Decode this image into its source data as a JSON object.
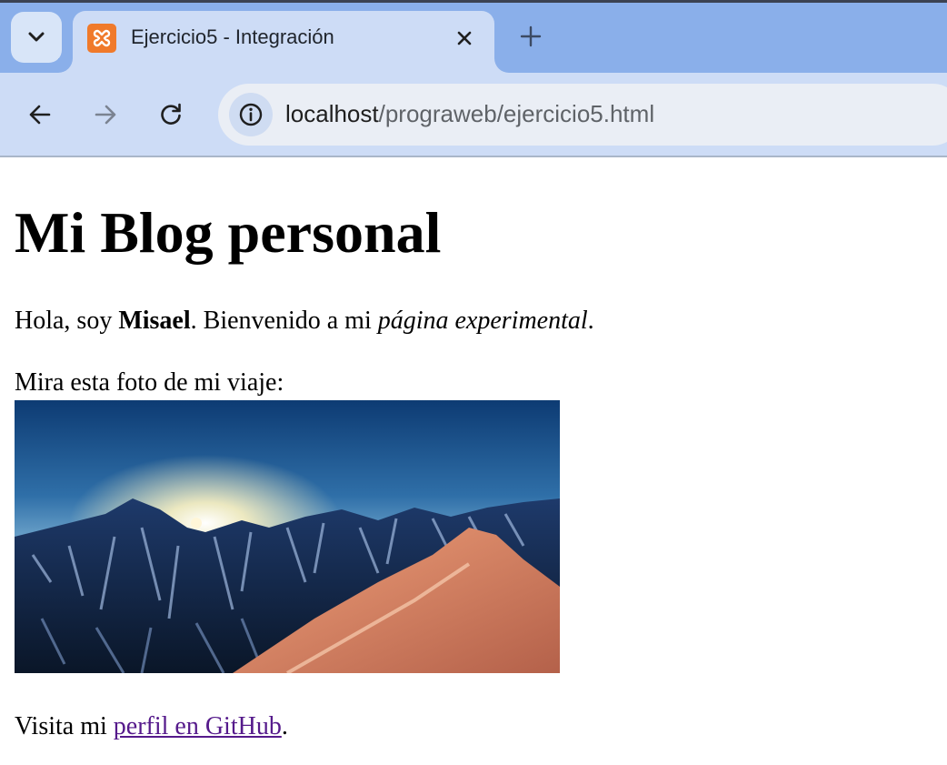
{
  "browser": {
    "tab": {
      "title": "Ejercicio5 - Integración",
      "favicon_icon": "xampp-icon",
      "favicon_color": "#f07a2b"
    },
    "tab_search_icon": "chevron-down-icon",
    "close_icon": "close-icon",
    "new_tab_icon": "plus-icon",
    "toolbar": {
      "back_icon": "arrow-left-icon",
      "forward_icon": "arrow-right-icon",
      "reload_icon": "reload-icon"
    },
    "address": {
      "host": "localhost",
      "path": "/prograweb/ejercicio5.html",
      "site_info_icon": "info-icon"
    },
    "colors": {
      "tabstrip": "#8aafea",
      "active_tab": "#cddcf6",
      "omnibox": "#eaeef5"
    }
  },
  "page": {
    "heading": "Mi Blog personal",
    "intro": {
      "prefix": "Hola, soy ",
      "name": "Misael",
      "middle": ". Bienvenido a mi ",
      "emphasis": "página experimental",
      "suffix": "."
    },
    "photo_caption": "Mira esta foto de mi viaje:",
    "photo_icon": "mountain-sunrise-photo",
    "footer": {
      "prefix": "Visita mi ",
      "link_text": "perfil en GitHub",
      "suffix": "."
    },
    "colors": {
      "visited_link": "#551a8b"
    }
  }
}
